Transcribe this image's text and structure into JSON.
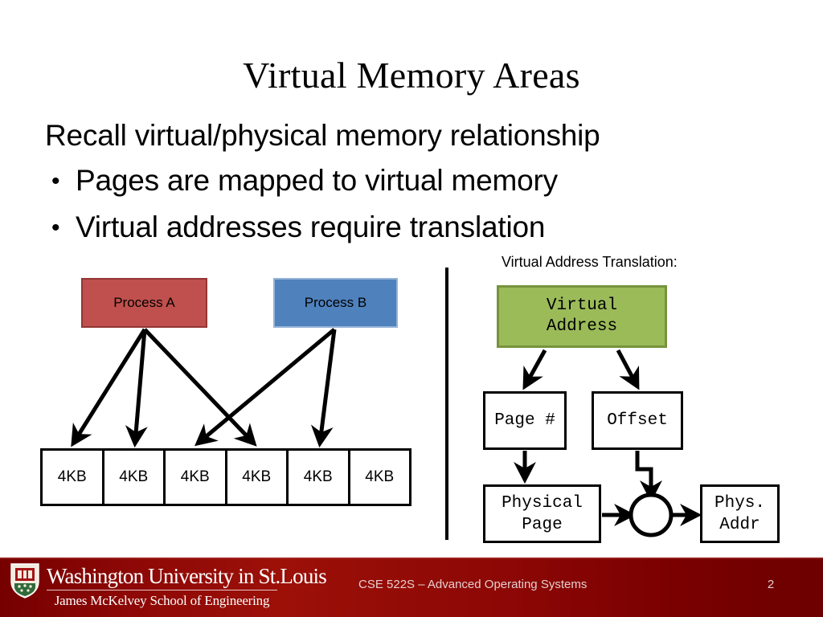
{
  "slide": {
    "title": "Virtual Memory Areas",
    "lead_line": "Recall virtual/physical memory relationship",
    "bullets": [
      "Pages are mapped to virtual memory",
      "Virtual addresses require translation"
    ],
    "bullet_glyph": "•"
  },
  "left_diagram": {
    "process_a_label": "Process A",
    "process_b_label": "Process B",
    "memory_cells": [
      "4KB",
      "4KB",
      "4KB",
      "4KB",
      "4KB",
      "4KB"
    ],
    "colors": {
      "process_a_fill": "#C0504D",
      "process_a_border": "#943634",
      "process_b_fill": "#4F81BD",
      "process_b_border": "#95B3D7",
      "cell_border": "#000000"
    }
  },
  "right_diagram": {
    "caption": "Virtual Address Translation:",
    "virtual_address_line1": "Virtual",
    "virtual_address_line2": "Address",
    "page_number_label": "Page #",
    "offset_label": "Offset",
    "physical_page_line1": "Physical",
    "physical_page_line2": "Page",
    "phys_addr_line1": "Phys.",
    "phys_addr_line2": "Addr",
    "combiner_label": "",
    "colors": {
      "virtual_address_fill": "#9BBB59",
      "virtual_address_border": "#77933C",
      "box_border": "#000000"
    }
  },
  "footer": {
    "university_name": "Washington University in St.Louis",
    "school_name": "James McKelvey School of Engineering",
    "course": "CSE 522S – Advanced Operating Systems",
    "page_number": "2",
    "background_color": "#8C0705"
  }
}
